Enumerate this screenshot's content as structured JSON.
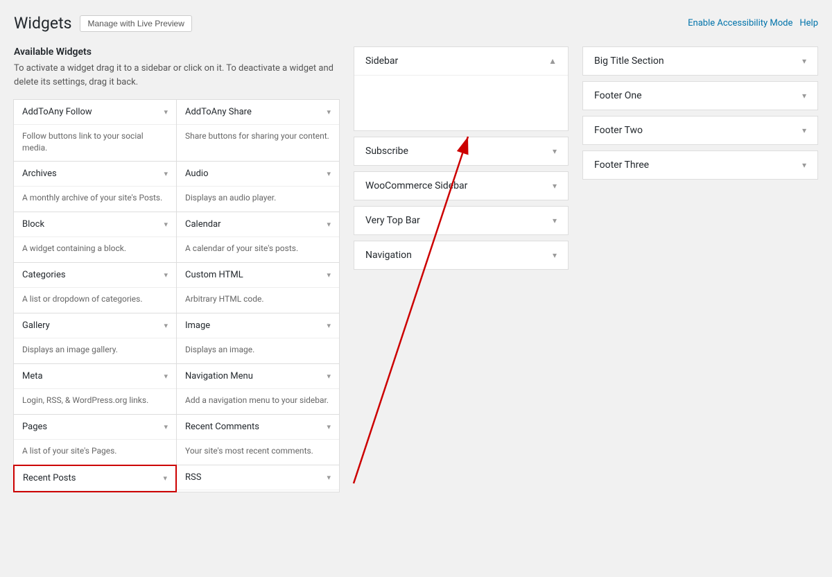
{
  "topBar": {
    "title": "Widgets",
    "manageBtn": "Manage with Live Preview",
    "enableLink": "Enable Accessibility Mode",
    "helpLink": "Help"
  },
  "availableWidgets": {
    "heading": "Available Widgets",
    "description": "To activate a widget drag it to a sidebar or click on it. To deactivate a widget and delete its settings, drag it back.",
    "widgets": [
      {
        "name": "AddToAny Follow",
        "desc": "Follow buttons link to your social media."
      },
      {
        "name": "AddToAny Share",
        "desc": "Share buttons for sharing your content."
      },
      {
        "name": "Archives",
        "desc": "A monthly archive of your site's Posts."
      },
      {
        "name": "Audio",
        "desc": "Displays an audio player."
      },
      {
        "name": "Block",
        "desc": "A widget containing a block."
      },
      {
        "name": "Calendar",
        "desc": "A calendar of your site's posts."
      },
      {
        "name": "Categories",
        "desc": "A list or dropdown of categories."
      },
      {
        "name": "Custom HTML",
        "desc": "Arbitrary HTML code."
      },
      {
        "name": "Gallery",
        "desc": "Displays an image gallery."
      },
      {
        "name": "Image",
        "desc": "Displays an image."
      },
      {
        "name": "Meta",
        "desc": "Login, RSS, & WordPress.org links."
      },
      {
        "name": "Navigation Menu",
        "desc": "Add a navigation menu to your sidebar."
      },
      {
        "name": "Pages",
        "desc": "A list of your site's Pages."
      },
      {
        "name": "Recent Comments",
        "desc": "Your site's most recent comments."
      },
      {
        "name": "Recent Posts",
        "desc": "",
        "highlighted": true
      },
      {
        "name": "RSS",
        "desc": ""
      }
    ]
  },
  "sidebars": [
    {
      "label": "Sidebar",
      "expanded": true
    },
    {
      "label": "Subscribe",
      "expanded": false
    },
    {
      "label": "WooCommerce Sidebar",
      "expanded": false
    },
    {
      "label": "Very Top Bar",
      "expanded": false
    },
    {
      "label": "Navigation",
      "expanded": false
    }
  ],
  "rightSections": [
    {
      "label": "Big Title Section"
    },
    {
      "label": "Footer One"
    },
    {
      "label": "Footer Two"
    },
    {
      "label": "Footer Three"
    }
  ]
}
